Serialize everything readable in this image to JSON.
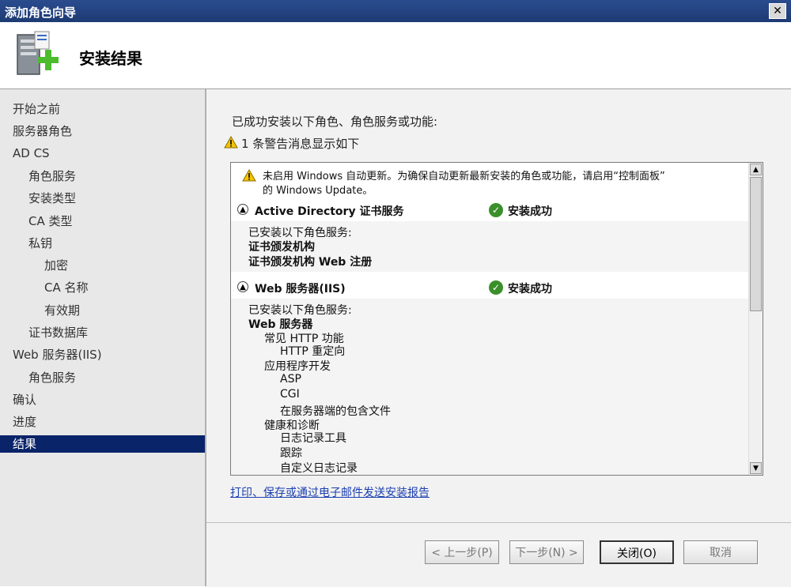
{
  "window": {
    "title": "添加角色向导",
    "close_label": "✕"
  },
  "header": {
    "title": "安装结果",
    "icon": "server-add-icon"
  },
  "nav": {
    "items": [
      {
        "label": "开始之前",
        "level": 0,
        "active": false
      },
      {
        "label": "服务器角色",
        "level": 0,
        "active": false
      },
      {
        "label": "AD CS",
        "level": 0,
        "active": false
      },
      {
        "label": "角色服务",
        "level": 1,
        "active": false
      },
      {
        "label": "安装类型",
        "level": 1,
        "active": false
      },
      {
        "label": "CA 类型",
        "level": 1,
        "active": false
      },
      {
        "label": "私钥",
        "level": 1,
        "active": false
      },
      {
        "label": "加密",
        "level": 2,
        "active": false
      },
      {
        "label": "CA 名称",
        "level": 2,
        "active": false
      },
      {
        "label": "有效期",
        "level": 2,
        "active": false
      },
      {
        "label": "证书数据库",
        "level": 1,
        "active": false
      },
      {
        "label": "Web 服务器(IIS)",
        "level": 0,
        "active": false
      },
      {
        "label": "角色服务",
        "level": 1,
        "active": false
      },
      {
        "label": "确认",
        "level": 0,
        "active": false
      },
      {
        "label": "进度",
        "level": 0,
        "active": false
      },
      {
        "label": "结果",
        "level": 0,
        "active": true
      }
    ]
  },
  "main": {
    "intro": "已成功安装以下角色、角色服务或功能:",
    "warning_count": "1 条警告消息显示如下",
    "warning_message_line1": "未启用 Windows 自动更新。为确保自动更新最新安装的角色或功能，请启用“控制面板”",
    "warning_message_line2": "的 Windows Update。",
    "sections": [
      {
        "name": "Active Directory 证书服务",
        "status": "安装成功",
        "intro": "已安装以下角色服务:",
        "items": [
          "证书颁发机构",
          "证书颁发机构 Web 注册"
        ]
      },
      {
        "name": "Web 服务器(IIS)",
        "status": "安装成功",
        "intro": "已安装以下角色服务:",
        "items": [
          "Web 服务器",
          "常见 HTTP 功能",
          "HTTP 重定向",
          "应用程序开发",
          "ASP",
          "CGI",
          "在服务器端的包含文件",
          "健康和诊断",
          "日志记录工具",
          "跟踪",
          "自定义日志记录"
        ]
      }
    ],
    "report_link": "打印、保存或通过电子邮件发送安装报告"
  },
  "buttons": {
    "previous": "< 上一步(P)",
    "next": "下一步(N) >",
    "close": "关闭(O)",
    "cancel": "取消"
  },
  "colors": {
    "title_bar": "#1d3a73",
    "selection": "#0a246a",
    "success_green": "#3a8f2a",
    "warning_yellow": "#f5c400",
    "link_blue": "#1a3fb0"
  }
}
